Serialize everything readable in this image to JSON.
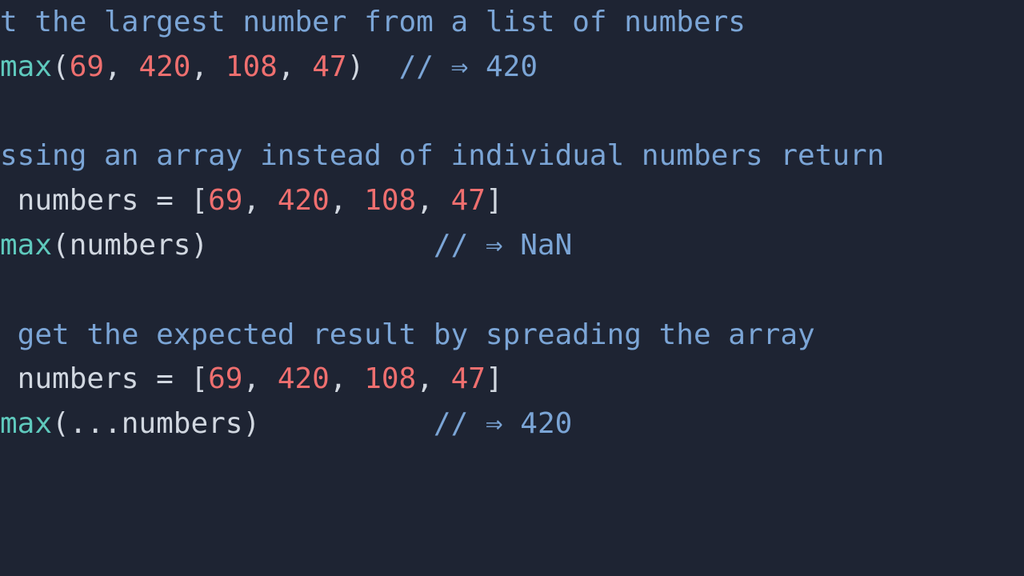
{
  "code": {
    "line1": {
      "comment": "t the largest number from a list of numbers"
    },
    "line2": {
      "func": "max",
      "open": "(",
      "n1": "69",
      "c1": ", ",
      "n2": "420",
      "c2": ", ",
      "n3": "108",
      "c3": ", ",
      "n4": "47",
      "close": ")",
      "gap": "  ",
      "comment": "// ⇒ 420"
    },
    "line3": {
      "comment": "ssing an array instead of individual numbers return"
    },
    "line4": {
      "lead": " numbers = [",
      "n1": "69",
      "c1": ", ",
      "n2": "420",
      "c2": ", ",
      "n3": "108",
      "c3": ", ",
      "n4": "47",
      "close": "]"
    },
    "line5": {
      "func": "max",
      "open": "(",
      "arg": "numbers",
      "close": ")",
      "gap": "             ",
      "comment": "// ⇒ NaN"
    },
    "line6": {
      "comment": " get the expected result by spreading the array"
    },
    "line7": {
      "lead": " numbers = [",
      "n1": "69",
      "c1": ", ",
      "n2": "420",
      "c2": ", ",
      "n3": "108",
      "c3": ", ",
      "n4": "47",
      "close": "]"
    },
    "line8": {
      "func": "max",
      "open": "(",
      "spread": "...",
      "arg": "numbers",
      "close": ")",
      "gap": "          ",
      "comment": "// ⇒ 420"
    }
  }
}
